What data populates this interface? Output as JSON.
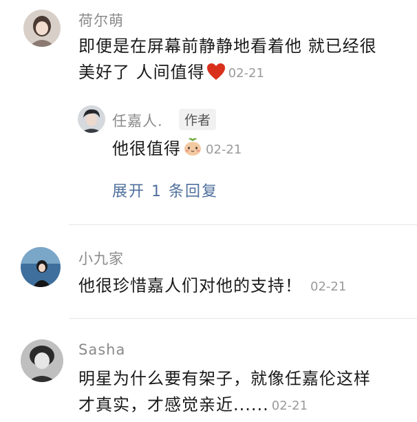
{
  "comments": [
    {
      "user": "荷尔萌",
      "line1": "即便是在屏幕前静静地看着他 就已经很",
      "line2": "美好了 人间值得",
      "emoji": "heart-icon",
      "time": "02-21",
      "reply": {
        "user": "任嘉人.",
        "badge": "作者",
        "text": "他很值得",
        "emoji": "peach-icon",
        "time": "02-21"
      },
      "expand_label": "展开 1 条回复"
    },
    {
      "user": "小九家",
      "text": "他很珍惜嘉人们对他的支持！",
      "time": "02-21"
    },
    {
      "user": "Sasha",
      "line1": "明星为什么要有架子，就像任嘉伦这样",
      "line2": "才真实，才感觉亲近......",
      "time": "02-21"
    }
  ],
  "colors": {
    "name": "#8a8a8a",
    "content": "#1a1a1a",
    "time": "#9a9a9a",
    "link": "#4f6f9c",
    "heart": "#d9301e"
  }
}
